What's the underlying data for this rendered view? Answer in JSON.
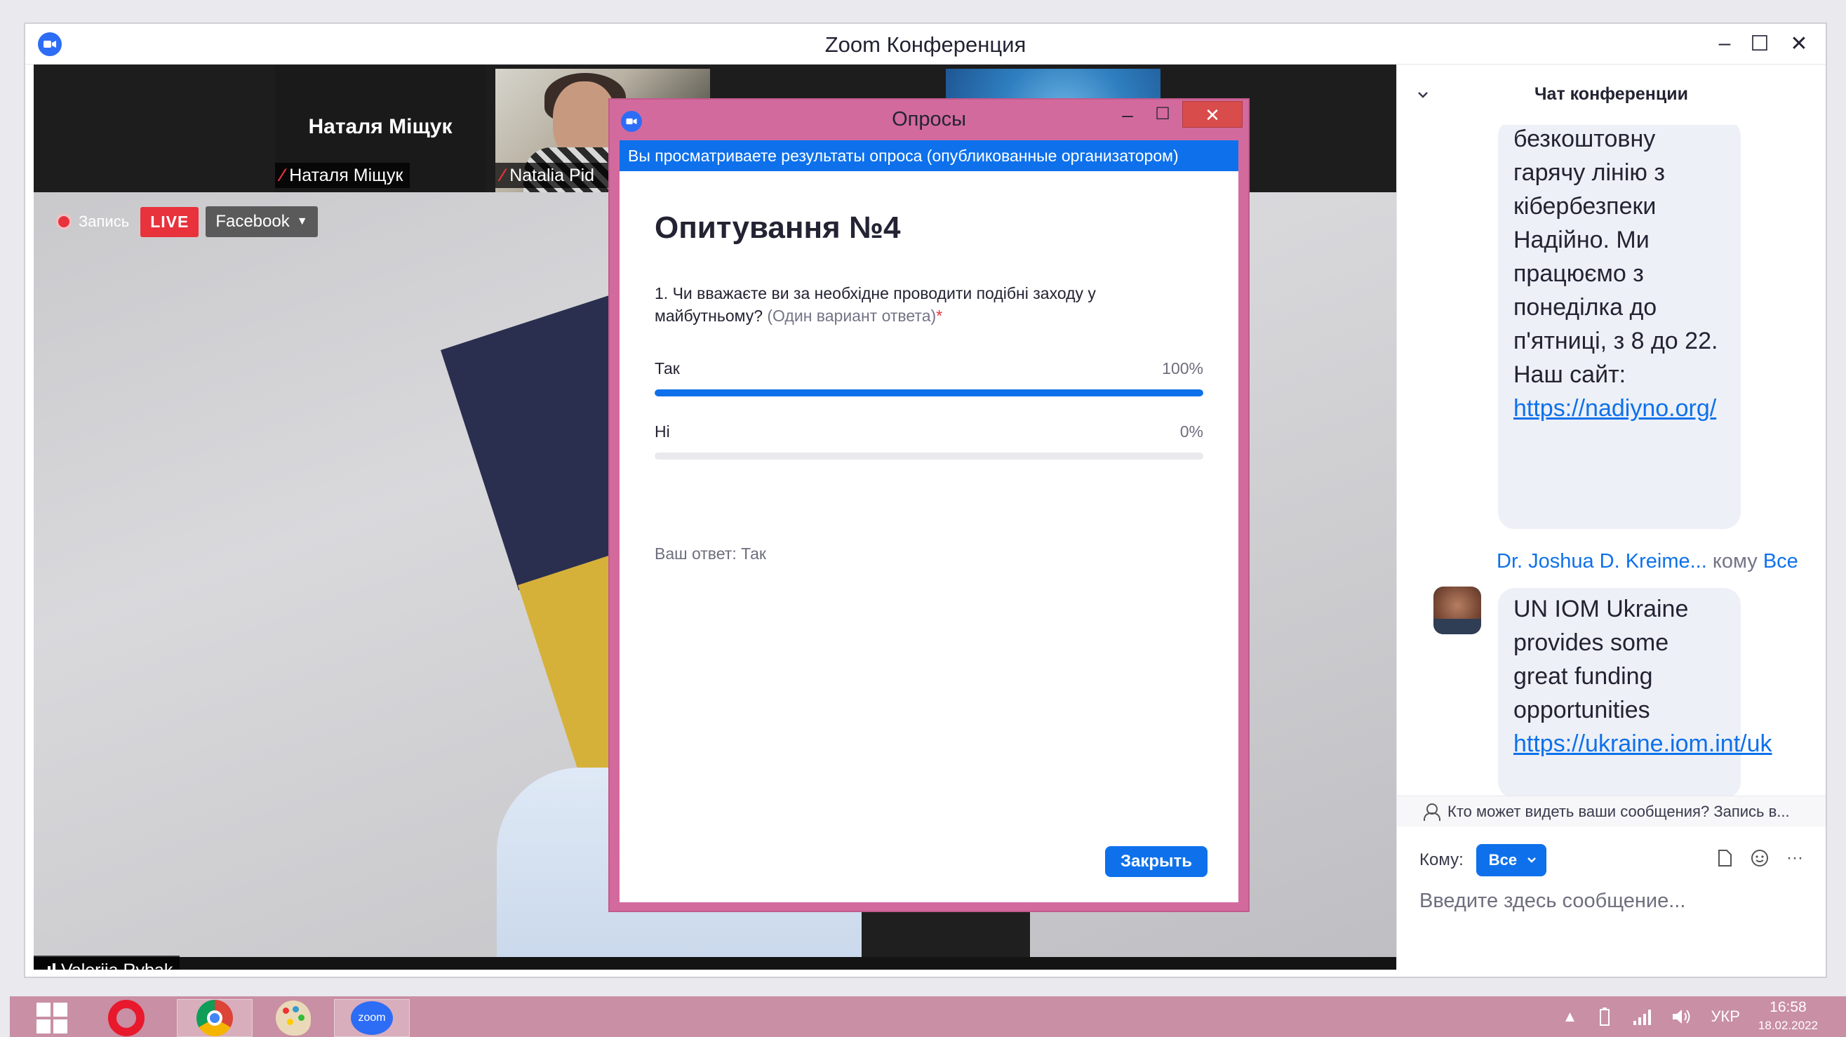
{
  "window": {
    "title": "Zoom Конференция",
    "controls": {
      "minimize": "–",
      "maximize": "☐",
      "close": "✕"
    }
  },
  "gallery": {
    "tiles": [
      {
        "display_name": "Наталя Міщук",
        "label": "Наталя Міщук",
        "muted": true
      },
      {
        "label": "Natalia Pid",
        "muted": true
      }
    ]
  },
  "recording": {
    "record_label": "Запись",
    "live_badge": "LIVE",
    "stream_target": "Facebook"
  },
  "speaker": {
    "name": "Valeriia Rybak"
  },
  "poll": {
    "window_title": "Опросы",
    "controls": {
      "minimize": "–",
      "maximize": "☐",
      "close": "✕"
    },
    "banner": "Вы просматриваете результаты опроса (опубликованные организатором)",
    "heading": "Опитування №4",
    "question": "1. Чи вважаєте ви за необхідне проводити подібні заходу у майбутньому?",
    "question_hint": "(Один вариант ответа)",
    "required_mark": "*",
    "options": [
      {
        "label": "Так",
        "percent_label": "100%",
        "percent": 100
      },
      {
        "label": "Ні",
        "percent_label": "0%",
        "percent": 0
      }
    ],
    "your_answer": "Ваш ответ: Так",
    "close_button": "Закрыть"
  },
  "chat": {
    "title": "Чат конференции",
    "messages": [
      {
        "text": "безкоштовну гарячу лінію з кібербезпеки Надійно. Ми працюємо з понеділка до п'ятниці, з 8 до 22. Наш сайт:",
        "link": "https://nadiyno.org/"
      },
      {
        "sender": "Dr. Joshua D. Kreime...",
        "to_word": "кому",
        "to_target": "Все",
        "text": "UN IOM Ukraine provides some great funding opportunities",
        "link": "https://ukraine.iom.int/uk"
      }
    ],
    "visibility_notice": "Кто может видеть ваши сообщения? Запись в...",
    "to_label": "Кому:",
    "to_value": "Все",
    "input_placeholder": "Введите здесь сообщение...",
    "more_tools": "···"
  },
  "taskbar": {
    "zoom_label": "zoom",
    "language": "УКР",
    "time": "16:58",
    "date": "18.02.2022"
  },
  "colors": {
    "zoom_blue": "#0e71eb",
    "live_red": "#e8323c",
    "poll_frame": "#d36a9e",
    "taskbar": "#c98fa4"
  }
}
